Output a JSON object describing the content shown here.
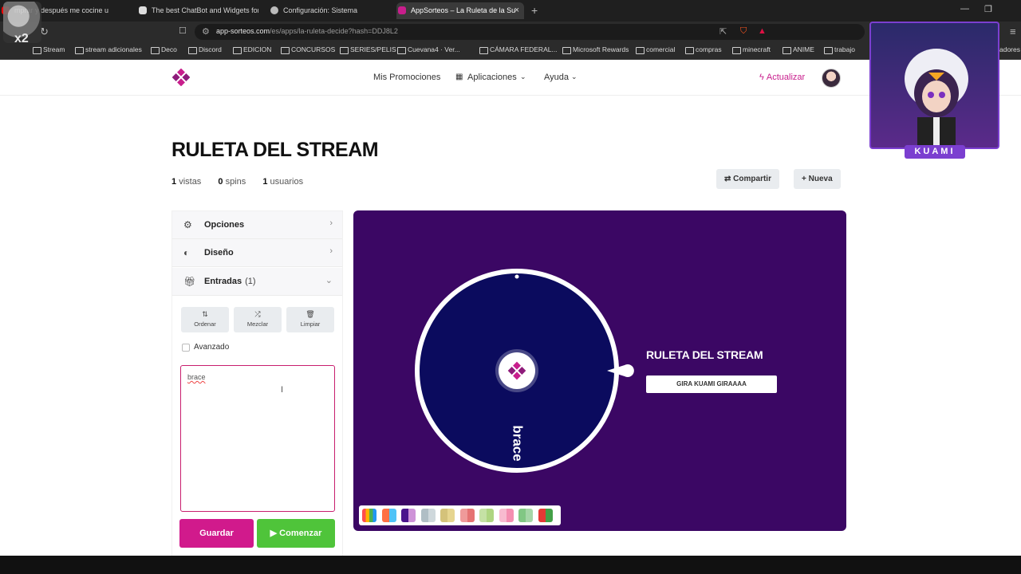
{
  "browser": {
    "tabs": [
      {
        "title": "mprar y después me cocine u",
        "icon_color": "#ff0000",
        "active": false
      },
      {
        "title": "The best ChatBot and Widgets for K",
        "icon_color": "#dddddd",
        "active": false
      },
      {
        "title": "Configuración: Sistema",
        "icon_color": "#bbbbbb",
        "active": false
      },
      {
        "title": "AppSorteos – La Ruleta de la Su",
        "icon_color": "#c81e8c",
        "active": true
      }
    ],
    "tab_close": "×",
    "new_tab": "+",
    "url_host": "app-sorteos.com",
    "url_path": "/es/apps/la-ruleta-decide?hash=DDJ8L2",
    "bookmarks": [
      "Stream",
      "stream adicionales",
      "Deco",
      "Discord",
      "EDICION",
      "CONCURSOS",
      "SERIES/PELIS",
      "Cuevana4 · Ver...",
      "CÁMARA FEDERAL...",
      "Microsoft Rewards",
      "comercial",
      "compras",
      "minecraft",
      "ANIME",
      "trabajo",
      "adores"
    ]
  },
  "header": {
    "nav": [
      "Mis Promociones",
      "Aplicaciones",
      "Ayuda"
    ],
    "update_label": "Actualizar"
  },
  "page": {
    "title": "RULETA DEL STREAM",
    "stats": {
      "views_value": "1",
      "views_label": "vistas",
      "spins_value": "0",
      "spins_label": "spins",
      "users_value": "1",
      "users_label": "usuarios"
    },
    "share_label": "Compartir",
    "new_label": "Nueva"
  },
  "panel": {
    "sections": [
      {
        "label": "Opciones",
        "icon": "gear-icon"
      },
      {
        "label": "Diseño",
        "icon": "palette-icon"
      },
      {
        "label": "Entradas",
        "icon": "gift-icon",
        "count": "(1)"
      }
    ],
    "tools": [
      {
        "label": "Ordenar",
        "icon": "sort-icon"
      },
      {
        "label": "Mezclar",
        "icon": "shuffle-icon"
      },
      {
        "label": "Limpiar",
        "icon": "trash-icon"
      }
    ],
    "advanced_label": "Avanzado",
    "entries_text": "brace",
    "save_label": "Guardar",
    "start_label": "Comenzar"
  },
  "wheel": {
    "title": "RULETA DEL STREAM",
    "button_label": "GIRA KUAMI GIRAAAA",
    "segment_label": "brace",
    "bg_color": "#3b0764",
    "segment_color": "#0b0b5e",
    "palette": [
      [
        "#ff4d4d",
        "#ffb300",
        "#4caf50",
        "#2196f3"
      ],
      [
        "#ff7043",
        "#4fc3f7"
      ],
      [
        "#4a148c",
        "#ce93d8"
      ],
      [
        "#b0bec5",
        "#cfd8dc"
      ],
      [
        "#d4c27a",
        "#e6d58f"
      ],
      [
        "#ef9a9a",
        "#e57373"
      ],
      [
        "#c5e1a5",
        "#aed581"
      ],
      [
        "#f8bbd0",
        "#f48fb1"
      ],
      [
        "#81c784",
        "#a5d6a7"
      ],
      [
        "#e53935",
        "#43a047"
      ]
    ]
  },
  "overlay": {
    "name": "KUAMI",
    "cam_badge": "x2"
  }
}
